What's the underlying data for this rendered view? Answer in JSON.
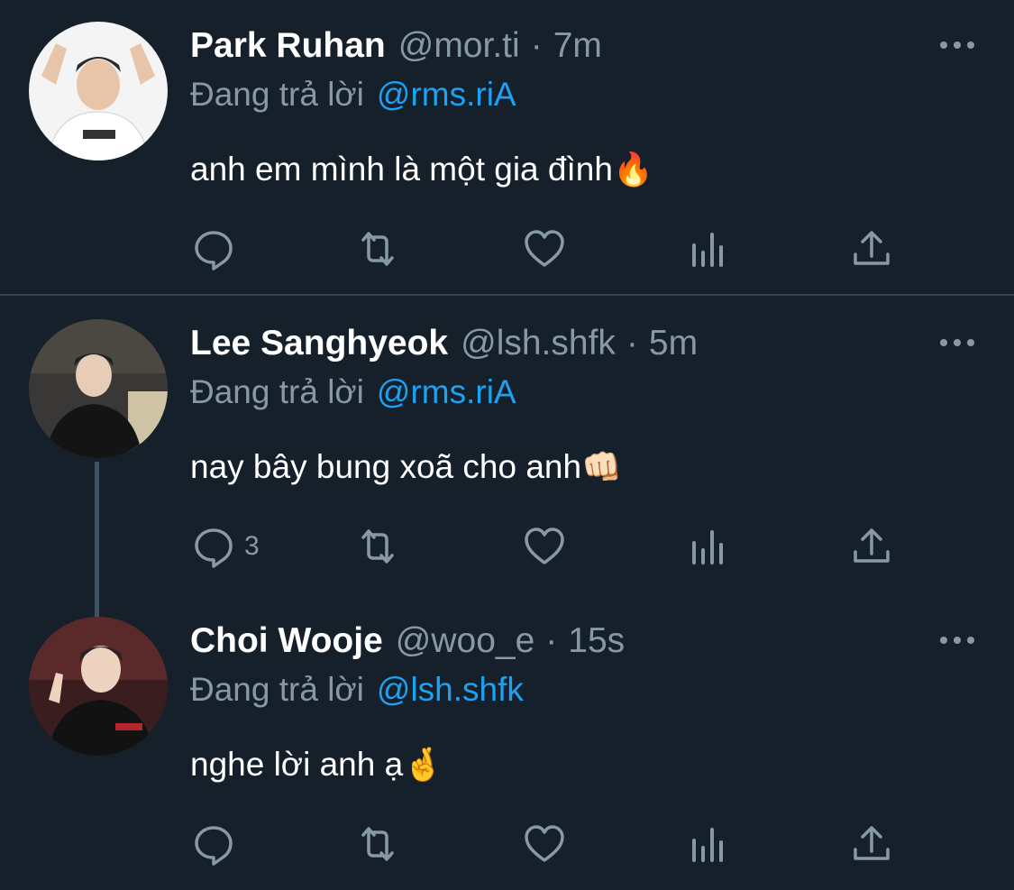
{
  "colors": {
    "background": "#15202b",
    "text": "#ffffff",
    "secondary_text": "#8899a6",
    "mention": "#1da1f2",
    "divider": "#38444d"
  },
  "tweets": [
    {
      "name": "Park Ruhan",
      "handle": "@mor.ti",
      "separator": "·",
      "time": "7m",
      "replying_label": "Đang trả lời",
      "replying_to": "@rms.riA",
      "text": "anh em mình là một gia đình",
      "emoji": "🔥",
      "reply_count": "",
      "icons": [
        "reply-icon",
        "retweet-icon",
        "like-icon",
        "analytics-icon",
        "share-icon",
        "more-icon"
      ]
    },
    {
      "name": "Lee Sanghyeok",
      "handle": "@lsh.shfk",
      "separator": "·",
      "time": "5m",
      "replying_label": "Đang trả lời",
      "replying_to": "@rms.riA",
      "text": "nay bây bung xoã cho anh",
      "emoji": "👊🏻",
      "reply_count": "3",
      "icons": [
        "reply-icon",
        "retweet-icon",
        "like-icon",
        "analytics-icon",
        "share-icon",
        "more-icon"
      ]
    },
    {
      "name": "Choi Wooje",
      "handle": "@woo_e",
      "separator": "·",
      "time": "15s",
      "replying_label": "Đang trả lời",
      "replying_to": "@lsh.shfk",
      "text": "nghe lời anh ạ",
      "emoji": "🤞",
      "reply_count": "",
      "icons": [
        "reply-icon",
        "retweet-icon",
        "like-icon",
        "analytics-icon",
        "share-icon",
        "more-icon"
      ]
    }
  ]
}
